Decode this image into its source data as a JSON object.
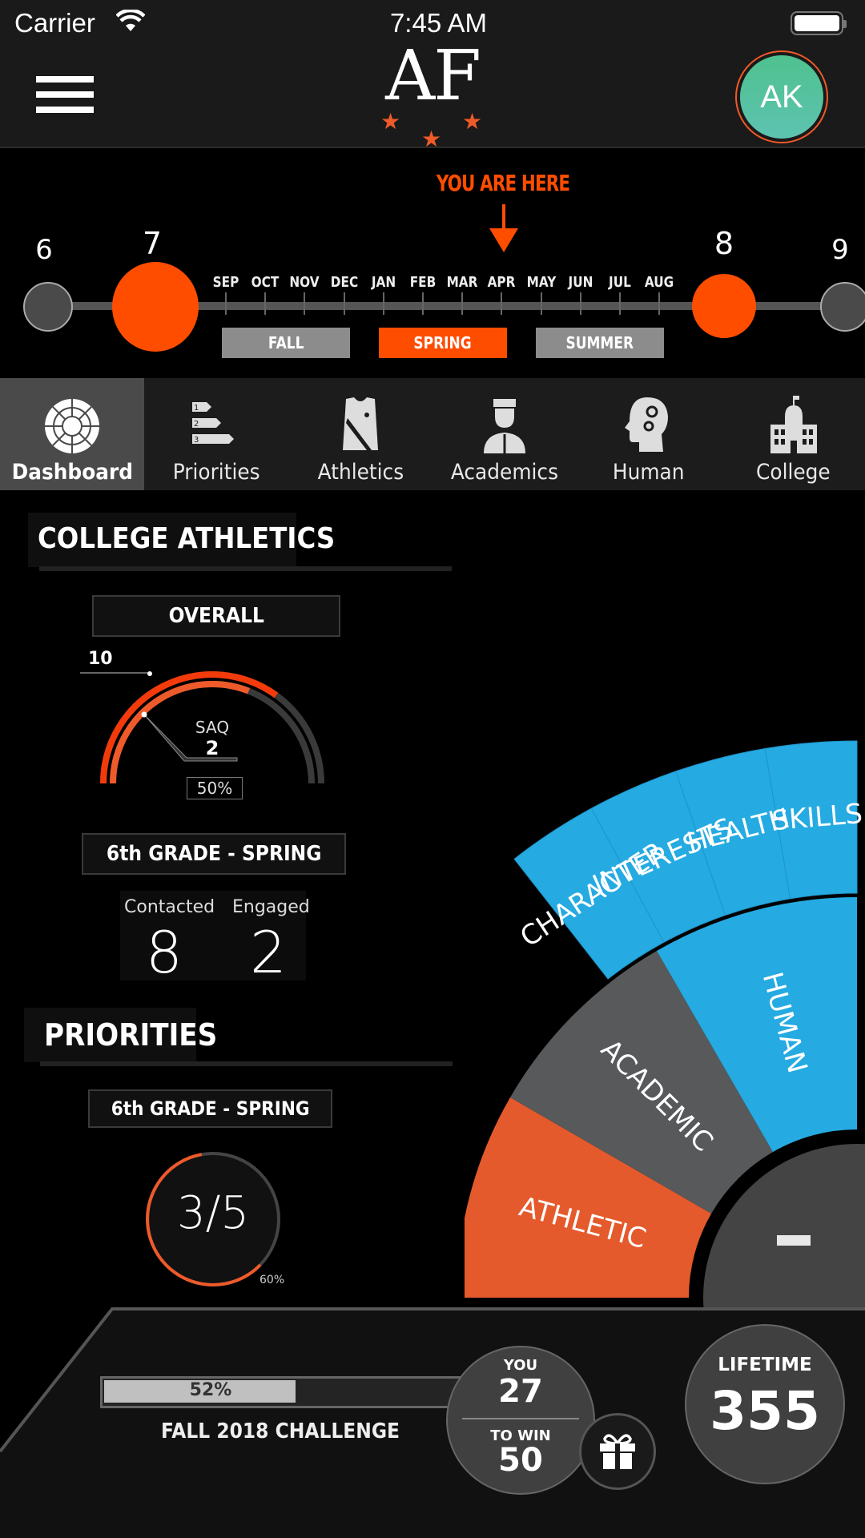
{
  "status_bar": {
    "carrier": "Carrier",
    "time": "7:45 AM",
    "wifi_icon": "wifi-icon",
    "battery_icon": "battery-icon"
  },
  "header": {
    "menu_icon": "hamburger-menu-icon",
    "logo_text": "AF",
    "logo_stars": [
      "★",
      "★",
      "★"
    ],
    "avatar_initials": "AK",
    "colors": {
      "accent": "#f05a28",
      "avatar": "#4fc18f"
    }
  },
  "timeline": {
    "marker_label": "YOU ARE HERE",
    "current_month": "APR",
    "grades": [
      {
        "label": "6",
        "state": "past"
      },
      {
        "label": "7",
        "state": "active"
      },
      {
        "label": "8",
        "state": "active"
      },
      {
        "label": "9",
        "state": "past"
      }
    ],
    "months": [
      "SEP",
      "OCT",
      "NOV",
      "DEC",
      "JAN",
      "FEB",
      "MAR",
      "APR",
      "MAY",
      "JUN",
      "JUL",
      "AUG"
    ],
    "seasons": [
      {
        "label": "FALL",
        "active": false
      },
      {
        "label": "SPRING",
        "active": true
      },
      {
        "label": "SUMMER",
        "active": false
      }
    ],
    "colors": {
      "active": "#ff4d00",
      "inactive": "#8c8c8c"
    }
  },
  "nav": {
    "tabs": [
      {
        "label": "Dashboard",
        "icon": "dashboard-wheel-icon",
        "active": true
      },
      {
        "label": "Priorities",
        "icon": "priorities-list-icon",
        "active": false
      },
      {
        "label": "Athletics",
        "icon": "jersey-icon",
        "active": false
      },
      {
        "label": "Academics",
        "icon": "graduate-icon",
        "active": false
      },
      {
        "label": "Human",
        "icon": "head-gears-icon",
        "active": false
      },
      {
        "label": "College",
        "icon": "college-building-icon",
        "active": false
      }
    ]
  },
  "college_athletics": {
    "title": "COLLEGE ATHLETICS",
    "overall_label": "OVERALL",
    "gauge": {
      "max_label": "10",
      "metric_label": "SAQ",
      "metric_value": "2",
      "percent_label": "50%",
      "outer_fraction": 0.7,
      "inner_fraction": 0.5
    },
    "period_label": "6th GRADE - SPRING",
    "stats": [
      {
        "label": "Contacted",
        "value": "8"
      },
      {
        "label": "Engaged",
        "value": "2"
      }
    ]
  },
  "priorities": {
    "title": "PRIORITIES",
    "period_label": "6th GRADE - SPRING",
    "progress_text": "3/5",
    "progress_percent_label": "60%",
    "progress_fraction": 0.6
  },
  "wheel": {
    "outer_segments": [
      "CHARACTER",
      "INTERESTS",
      "HEALTH",
      "SKILLS"
    ],
    "inner_segments": [
      {
        "label": "ATHLETIC",
        "color": "#e45a2c"
      },
      {
        "label": "ACADEMIC",
        "color": "#58595b"
      },
      {
        "label": "HUMAN",
        "color": "#25aae2"
      }
    ],
    "outer_color": "#25aae2",
    "center_button_icon": "minus-icon"
  },
  "challenge": {
    "progress_label": "52%",
    "progress_fraction": 0.52,
    "title": "FALL 2018 CHALLENGE",
    "you_label": "YOU",
    "you_value": "27",
    "to_win_label": "TO WIN",
    "to_win_value": "50",
    "gift_icon": "gift-icon",
    "lifetime_label": "LIFETIME",
    "lifetime_value": "355"
  }
}
